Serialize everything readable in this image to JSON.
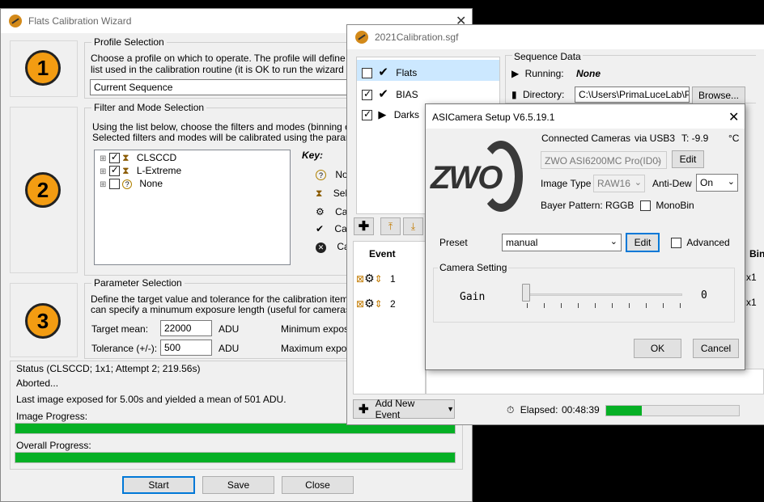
{
  "flats": {
    "title": "Flats Calibration Wizard",
    "profile": {
      "group_title": "Profile Selection",
      "desc1": "Choose a profile on which to operate.  The profile will define the cam",
      "desc2": "list used in the calibration routine (it is OK to run the wizard on the cu",
      "selected": "Current Sequence"
    },
    "filter": {
      "group_title": "Filter and Mode Selection",
      "desc1": "Using the list below, choose the filters and modes (binning or ISO) y",
      "desc2": "Selected filters and modes will be calibrated using the parameters de",
      "items": [
        {
          "label": "CLSCCD",
          "checked": true
        },
        {
          "label": "L-Extreme",
          "checked": true
        },
        {
          "label": "None",
          "checked": false
        }
      ],
      "key_title": "Key:",
      "key_items": [
        "No",
        "Sel",
        "Cal",
        "Cal",
        "Cal"
      ]
    },
    "param": {
      "group_title": "Parameter Selection",
      "desc1": "Define the target value and tolerance for the calibration items (selec",
      "desc2": "can specify a minumum exposure length (useful for cameras with me",
      "target_label": "Target mean:",
      "target_value": "22000",
      "tol_label": "Tolerance (+/-):",
      "tol_value": "500",
      "unit": "ADU",
      "min_exp": "Minimum exposur",
      "max_exp": "Maximum exposur"
    },
    "status": {
      "title": "Status (CLSCCD; 1x1; Attempt 2; 219.56s)",
      "aborted": "Aborted...",
      "last": "Last image exposed for 5.00s and yielded a mean of 501 ADU.",
      "image_progress_label": "Image Progress:",
      "overall_progress_label": "Overall Progress:",
      "image_progress": 1.0,
      "overall_progress": 1.0
    },
    "buttons": {
      "start": "Start",
      "save": "Save",
      "close": "Close"
    },
    "steps": [
      "1",
      "2",
      "3"
    ]
  },
  "seq": {
    "title": "2021Calibration.sgf",
    "targets": [
      "Flats",
      "BIAS",
      "Darks"
    ],
    "sequence_data_label": "Sequence Data",
    "running_label": "Running:",
    "running_value": "None",
    "directory_label": "Directory:",
    "directory_value": "C:\\Users\\PrimaLuceLab\\Pic",
    "browse": "Browse...",
    "event_header": "Event",
    "events": [
      "1",
      "2"
    ],
    "bin_header": "Bin",
    "bin_values": [
      "x1",
      "x1"
    ],
    "add_event": "Add New Event",
    "elapsed_label": "Elapsed:",
    "elapsed_value": "00:48:39",
    "elapsed_progress": 0.27
  },
  "asi": {
    "title": "ASICamera Setup V6.5.19.1",
    "logo_text": "ZWO",
    "connected_label": "Connected Cameras",
    "usb": "via USB3",
    "temp": "T:  -9.9",
    "temp_unit": "°C",
    "camera": "ZWO ASI6200MC Pro(ID0)",
    "edit": "Edit",
    "image_type_label": "Image Type",
    "image_type": "RAW16",
    "anti_dew_label": "Anti-Dew",
    "anti_dew": "On",
    "bayer": "Bayer Pattern: RGGB",
    "monobin": "MonoBin",
    "preset_label": "Preset",
    "preset": "manual",
    "preset_edit": "Edit",
    "advanced": "Advanced",
    "camera_setting": "Camera Setting",
    "gain_label": "Gain",
    "gain_value": "0",
    "ok": "OK",
    "cancel": "Cancel"
  }
}
